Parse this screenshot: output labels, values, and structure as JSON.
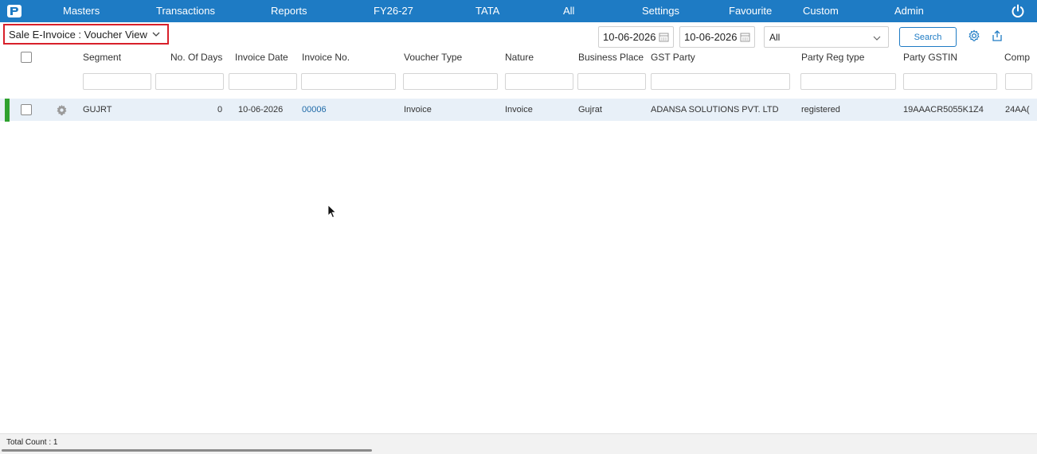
{
  "nav": {
    "items": [
      "Masters",
      "Transactions",
      "Reports",
      "FY26-27",
      "TATA",
      "All",
      "Settings",
      "Favourite",
      "Custom",
      "Admin"
    ]
  },
  "toolbar": {
    "view_title": "Sale E-Invoice : Voucher View",
    "from_date": "10-06-2026",
    "to_date": "10-06-2026",
    "filter_select": "All",
    "search_label": "Search"
  },
  "grid": {
    "columns": [
      "Segment",
      "No. Of Days",
      "Invoice Date",
      "Invoice No.",
      "Voucher Type",
      "Nature",
      "Business Place",
      "GST Party",
      "Party Reg type",
      "Party GSTIN",
      "Comp"
    ],
    "rows": [
      {
        "segment": "GUJRT",
        "days": "0",
        "invoice_date": "10-06-2026",
        "invoice_no": "00006",
        "voucher_type": "Invoice",
        "nature": "Invoice",
        "business_place": "Gujrat",
        "gst_party": "ADANSA SOLUTIONS PVT. LTD",
        "party_reg_type": "registered",
        "party_gstin": "19AAACR5055K1Z4",
        "comp": "24AA("
      }
    ]
  },
  "footer": {
    "total_count": "Total Count : 1"
  },
  "colors": {
    "topbar": "#1e7bc4",
    "highlight_border": "#d8202a",
    "row_status": "#2ea12e",
    "link": "#1f6aa8"
  },
  "icons": [
    "app-logo-icon",
    "power-icon",
    "chevron-down-icon",
    "calendar-icon",
    "settings-icon",
    "export-icon",
    "row-gear-icon",
    "mouse-cursor-icon"
  ]
}
